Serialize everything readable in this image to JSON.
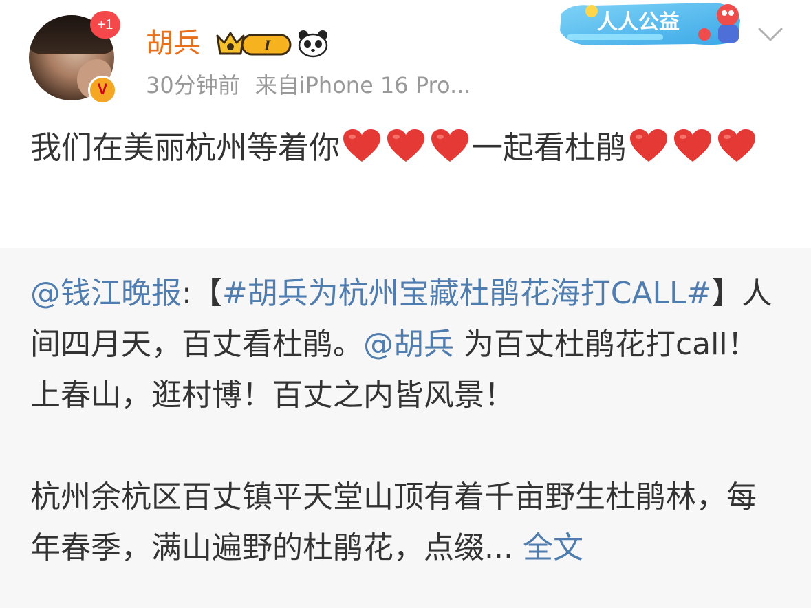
{
  "post": {
    "avatar_badge": "+1",
    "verified_badge": "V",
    "username": "胡兵",
    "vip_level": "I",
    "time": "30分钟前",
    "source": "来自iPhone 16 Pro...",
    "promo_label": "人人公益",
    "text_main": "我们在美丽杭州等着你",
    "text_mid": "一起看杜鹃",
    "icons": {
      "vip": "crown-vip-icon",
      "panda": "panda-icon",
      "heart": "red-heart-emoji",
      "chevron": "chevron-down-icon"
    }
  },
  "repost": {
    "mention_source": "@钱江晚报",
    "colon_bracket": ":【",
    "topic": "#胡兵为杭州宝藏杜鹃花海打CALL#",
    "after_topic": "】人间四月天，百丈看杜鹃。",
    "mention_user": "@胡兵",
    "continuation": " 为百丈杜鹃花打call！上春山，逛村博！百丈之内皆风景！",
    "para2": "杭州余杭区百丈镇平天堂山顶有着千亩野生杜鹃林，每年春季，满山遍野的杜鹃花，点缀...",
    "full_text_link": " 全文"
  },
  "colors": {
    "username": "#e8701a",
    "link": "#507daf",
    "meta": "#999999",
    "text": "#333333",
    "repost_bg": "#f7f7f7",
    "heart": "#e53935"
  }
}
